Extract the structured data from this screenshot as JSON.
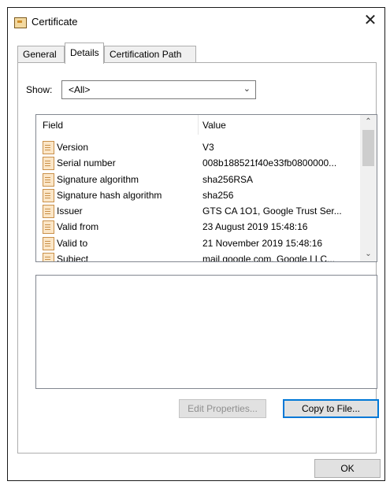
{
  "window": {
    "title": "Certificate",
    "close_glyph": "✕",
    "icon": "certificate-icon"
  },
  "tabs": [
    {
      "label": "General",
      "selected": false
    },
    {
      "label": "Details",
      "selected": true
    },
    {
      "label": "Certification Path",
      "selected": false
    }
  ],
  "show": {
    "label": "Show:",
    "value": "<All>"
  },
  "list": {
    "columns": {
      "field": "Field",
      "value": "Value"
    },
    "rows": [
      {
        "field": "Version",
        "value": "V3"
      },
      {
        "field": "Serial number",
        "value": "008b188521f40e33fb0800000..."
      },
      {
        "field": "Signature algorithm",
        "value": "sha256RSA"
      },
      {
        "field": "Signature hash algorithm",
        "value": "sha256"
      },
      {
        "field": "Issuer",
        "value": "GTS CA 1O1, Google Trust Ser..."
      },
      {
        "field": "Valid from",
        "value": "23 August 2019 15:48:16"
      },
      {
        "field": "Valid to",
        "value": "21 November 2019 15:48:16"
      },
      {
        "field": "Subject",
        "value": "mail.google.com, Google LLC..."
      }
    ]
  },
  "buttons": {
    "edit_properties": "Edit Properties...",
    "copy_to_file": "Copy to File...",
    "ok": "OK"
  },
  "colors": {
    "focus_border": "#0078d7",
    "field_icon": "#fbe6c7"
  }
}
